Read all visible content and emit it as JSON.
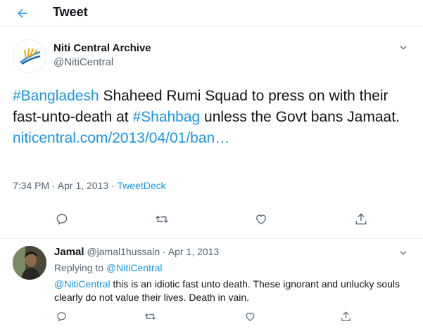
{
  "header": {
    "title": "Tweet",
    "back_icon": "arrow-left-icon"
  },
  "tweet": {
    "author_name": "Niti Central Archive",
    "author_handle": "@NitiCentral",
    "text_parts": {
      "hashtag1": "#Bangladesh",
      "text1": " Shaheed Rumi Squad to press on with their fast-unto-death at ",
      "hashtag2": "#Shahbag",
      "text2": " unless the Govt bans Jamaat.",
      "url": "niticentral.com/2013/04/01/ban…"
    },
    "time": "7:34 PM · Apr 1, 2013 · ",
    "source": "TweetDeck",
    "actions": [
      "reply-icon",
      "retweet-icon",
      "like-icon",
      "share-icon"
    ]
  },
  "reply": {
    "author_name": "Jamal",
    "author_handle": "@jamal1hussain",
    "separator": " · ",
    "date": "Apr 1, 2013",
    "replying_to_label": "Replying to ",
    "replying_to_handle": "@NitiCentral",
    "mention": "@NitiCentral",
    "text": " this is an idiotic fast unto death. These ignorant and unlucky souls clearly do not value their lives. Death in vain.",
    "actions": [
      "reply-icon",
      "retweet-icon",
      "like-icon",
      "share-icon"
    ]
  },
  "colors": {
    "accent": "#1b95e0",
    "muted": "#536471",
    "text": "#0f1419",
    "divider": "#eff3f4"
  }
}
